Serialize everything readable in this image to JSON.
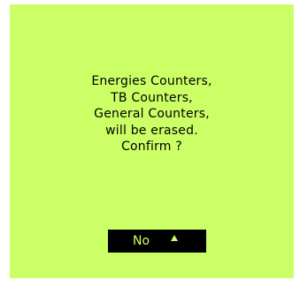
{
  "dialog": {
    "message_lines": [
      "Energies Counters,",
      "TB Counters,",
      "General Counters,",
      "will be erased.",
      "Confirm ?"
    ],
    "button_label": "No",
    "button_icon": "arrow-up-icon"
  },
  "colors": {
    "screen_background": "#ccff66",
    "text": "#000000",
    "button_background": "#000000",
    "button_text": "#ccff66"
  }
}
